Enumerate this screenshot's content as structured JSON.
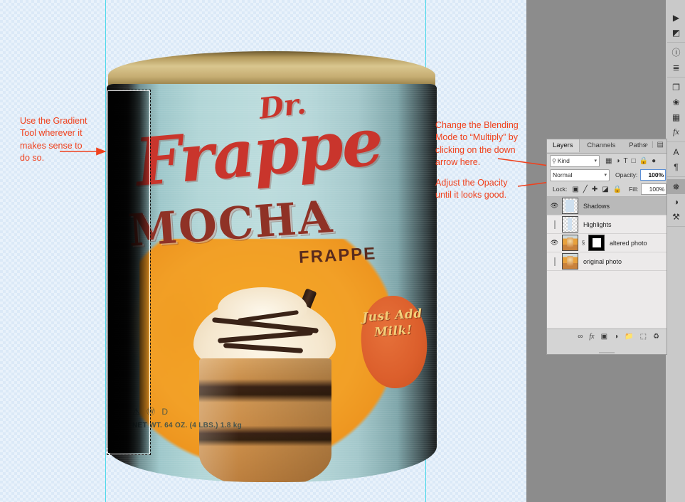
{
  "annotations": [
    {
      "id": "gradient-tool",
      "text": "Use the Gradient\nTool wherever it\nmakes sense to\ndo so."
    },
    {
      "id": "blending-mode",
      "text": "Change the Blending\nMode to “Multiply” by\nclicking on the down\narrow here."
    },
    {
      "id": "opacity",
      "text": "Adjust the Opacity\nuntil it looks good."
    }
  ],
  "annotation_color": "#f0411d",
  "guide_color": "#4ad8ea",
  "canvas": {
    "background": "transparent-checkerboard",
    "product": {
      "brand_prefix": "Dr.",
      "brand_name": "Frappe",
      "flavor": "MOCHA",
      "flavor_sub": "FRAPPE",
      "badge_text": "Just\nAdd\nMilk!",
      "net_weight": "NET WT. 64 OZ.\n(4 LBS.) 1.8 kg",
      "marks": "⚠ Ⓦ D"
    }
  },
  "panel": {
    "tabs": [
      {
        "label": "Layers",
        "active": true
      },
      {
        "label": "Channels",
        "active": false
      },
      {
        "label": "Paths",
        "active": false
      }
    ],
    "expand_icon": "»",
    "divider": "|",
    "menu_icon": "▤",
    "filter": {
      "search_icon": "⚲",
      "kind_label": "Kind",
      "caret": "▾",
      "icons": [
        "image-filter-icon",
        "adjustment-filter-icon",
        "type-filter-icon",
        "shape-filter-icon",
        "smartobject-filter-icon",
        "filter-toggle-icon"
      ],
      "type_glyph": "T",
      "toggle_glyph": "●"
    },
    "blend": {
      "mode": "Normal",
      "caret": "▾",
      "opacity_label": "Opacity:",
      "opacity_value": "100%",
      "opacity_caret": "▾"
    },
    "lock": {
      "label": "Lock:",
      "fill_label": "Fill:",
      "fill_value": "100%",
      "fill_caret": "▾",
      "icons": [
        "lock-transparent-icon",
        "lock-image-icon",
        "lock-position-icon",
        "lock-artboard-icon",
        "lock-all-icon"
      ]
    },
    "layers": [
      {
        "name": "Shadows",
        "visible": true,
        "selected": true,
        "thumb": "checker-shape",
        "has_mask": false
      },
      {
        "name": "Highlights",
        "visible": false,
        "selected": false,
        "thumb": "checker-shape2",
        "has_mask": false
      },
      {
        "name": "altered photo",
        "visible": true,
        "selected": false,
        "thumb": "photo",
        "has_mask": true
      },
      {
        "name": "original photo",
        "visible": false,
        "selected": false,
        "thumb": "photo",
        "has_mask": false
      }
    ],
    "footer_icons": [
      "link-layers-icon",
      "layer-style-fx-icon",
      "add-mask-icon",
      "adjustment-layer-icon",
      "new-group-icon",
      "new-layer-icon",
      "delete-layer-icon"
    ],
    "footer_glyphs": {
      "link": "∞",
      "fx": "fx",
      "mask": "▣",
      "adjustment": "◑",
      "group": "◱",
      "new": "⬚",
      "trash": "Ὕ1"
    }
  },
  "rail": {
    "groups": [
      {
        "icons": [
          {
            "name": "actions-play-icon",
            "glyph": "▶"
          },
          {
            "name": "camera-raw-icon",
            "glyph": "◩"
          }
        ]
      },
      {
        "icons": [
          {
            "name": "info-icon",
            "glyph": "ⓘ"
          },
          {
            "name": "adjustments-icon",
            "glyph": "☰"
          }
        ]
      },
      {
        "icons": [
          {
            "name": "libraries-icon",
            "glyph": "❐"
          },
          {
            "name": "color-icon",
            "glyph": "✿"
          },
          {
            "name": "swatches-icon",
            "glyph": "▦"
          },
          {
            "name": "styles-fx-icon",
            "glyph": "fx"
          }
        ]
      },
      {
        "icons": [
          {
            "name": "character-icon",
            "glyph": "A"
          },
          {
            "name": "paragraph-icon",
            "glyph": "¶"
          }
        ]
      },
      {
        "icons": [
          {
            "name": "layers-icon",
            "glyph": "☰",
            "active": true
          },
          {
            "name": "channels-icon",
            "glyph": "◑"
          },
          {
            "name": "paths-icon",
            "glyph": "⚒"
          }
        ]
      }
    ]
  }
}
